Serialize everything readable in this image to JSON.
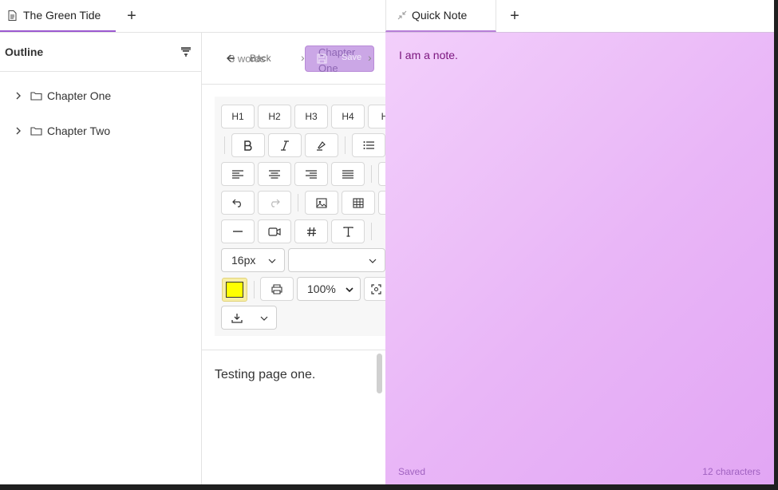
{
  "tabs": {
    "doc_tab": "The Green Tide",
    "add": "+"
  },
  "outline": {
    "title": "Outline",
    "items": [
      {
        "label": "Chapter One"
      },
      {
        "label": "Chapter Two"
      }
    ]
  },
  "editor": {
    "word_count": "3 words",
    "back_label": "Back",
    "breadcrumb": "Chapter One",
    "save_label": "Save",
    "toolbar": {
      "headings": [
        "H1",
        "H2",
        "H3",
        "H4",
        "H"
      ],
      "font_size": "16px",
      "font_family": "",
      "zoom": "100%",
      "highlight_color": "#ffff00"
    },
    "content": "Testing page one."
  },
  "note": {
    "tab_label": "Quick Note",
    "add": "+",
    "text": "I am a note.",
    "status": "Saved",
    "char_count": "12 characters"
  },
  "colors": {
    "accent": "#9b59d0",
    "note_text": "#7a147d",
    "note_meta": "#a062c0"
  }
}
